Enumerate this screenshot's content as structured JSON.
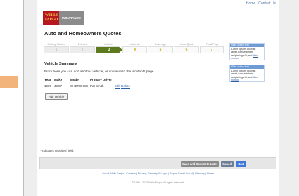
{
  "top_links": {
    "home": "Home",
    "separator": " | ",
    "contact": "Contact Us"
  },
  "logo": {
    "line1": "WELLS",
    "line2": "FARGO",
    "product": "INSURANCE"
  },
  "page_title": "Auto and Homeowners Quotes",
  "steps": [
    {
      "label": "Getting Started",
      "number": "1",
      "state": "done"
    },
    {
      "label": "Drivers",
      "number": "2",
      "state": "done"
    },
    {
      "label": "Vehicle",
      "number": "3",
      "state": "current"
    },
    {
      "label": "Incidents",
      "number": "4",
      "state": "future"
    },
    {
      "label": "Coverage",
      "number": "5",
      "state": "future"
    },
    {
      "label": "Home Quote",
      "number": "6",
      "state": "future"
    },
    {
      "label": "Final Page",
      "number": "7",
      "state": "future"
    }
  ],
  "side_boxes": [
    {
      "header": "Side action text",
      "body": "Lorem ipsum dolor sit amet, consectetuer adipiscing elit, sed",
      "link": "diam nonum"
    },
    {
      "header": "Side action text",
      "body": "Lorem ipsum dolor sit amet, consectetuer adipiscing elit, sed",
      "link": "diam nonum"
    }
  ],
  "vehicle_summary": {
    "title": "Vehicle Summary",
    "intro": "From here you can add another vehicle, or continue to the incidents page.",
    "headers": {
      "year": "Year",
      "make": "Make",
      "model": "Model",
      "driver": "Primary Driver"
    },
    "rows": [
      {
        "year": "1989",
        "make": "JEEP",
        "model": "CHEROKEE",
        "driver": "Pat Smith",
        "edit": "Edit",
        "delete": "Delete"
      }
    ],
    "add_button": "Add Vehicle"
  },
  "required_note": "*Indicates required field.",
  "actions": {
    "save": "Save and Complete Later",
    "cancel": "Cancel",
    "next": "Next"
  },
  "footer": {
    "links": "About Wells Fargo | Careers | Privacy, Security & Legal | Report Email Fraud | Sitemap | Home",
    "copyright": "© 1999 - 2010 Wells Fargo. All rights reserved."
  },
  "colors": {
    "brand_red": "#b5191f",
    "brand_gold": "#f6d04d",
    "step_current": "#5d7b1e",
    "accent_orange": "#f2b47a",
    "link_blue": "#2b5fa8",
    "next_blue": "#3f78d6"
  }
}
